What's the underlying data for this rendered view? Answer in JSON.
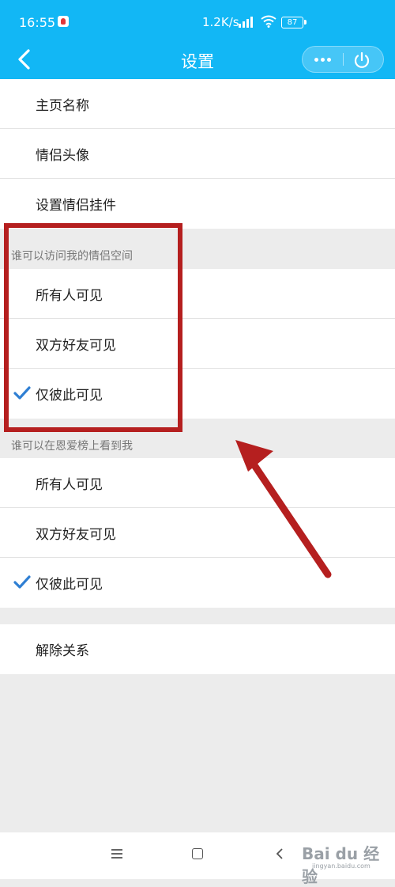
{
  "status_bar": {
    "time": "16:55",
    "network_speed": "1.2K/s",
    "battery": "87"
  },
  "nav": {
    "title": "设置",
    "back_icon": "chevron-left-icon",
    "more_icon": "more-dots-icon",
    "power_icon": "power-icon",
    "bg_color": "#12b7f5"
  },
  "basic_settings": [
    {
      "label": "主页名称"
    },
    {
      "label": "情侣头像"
    },
    {
      "label": "设置情侣挂件"
    }
  ],
  "visit_section": {
    "header": "谁可以访问我的情侣空间",
    "options": [
      {
        "label": "所有人可见",
        "checked": false
      },
      {
        "label": "双方好友可见",
        "checked": false
      },
      {
        "label": "仅彼此可见",
        "checked": true
      }
    ]
  },
  "ranking_section": {
    "header": "谁可以在恩爱榜上看到我",
    "options": [
      {
        "label": "所有人可见",
        "checked": false
      },
      {
        "label": "双方好友可见",
        "checked": false
      },
      {
        "label": "仅彼此可见",
        "checked": true
      }
    ]
  },
  "relation": {
    "label": "解除关系"
  },
  "annotation": {
    "highlight_color": "#b51f1f"
  },
  "watermark": {
    "text": "Bai du 经验",
    "sub": "jingyan.baidu.com"
  }
}
